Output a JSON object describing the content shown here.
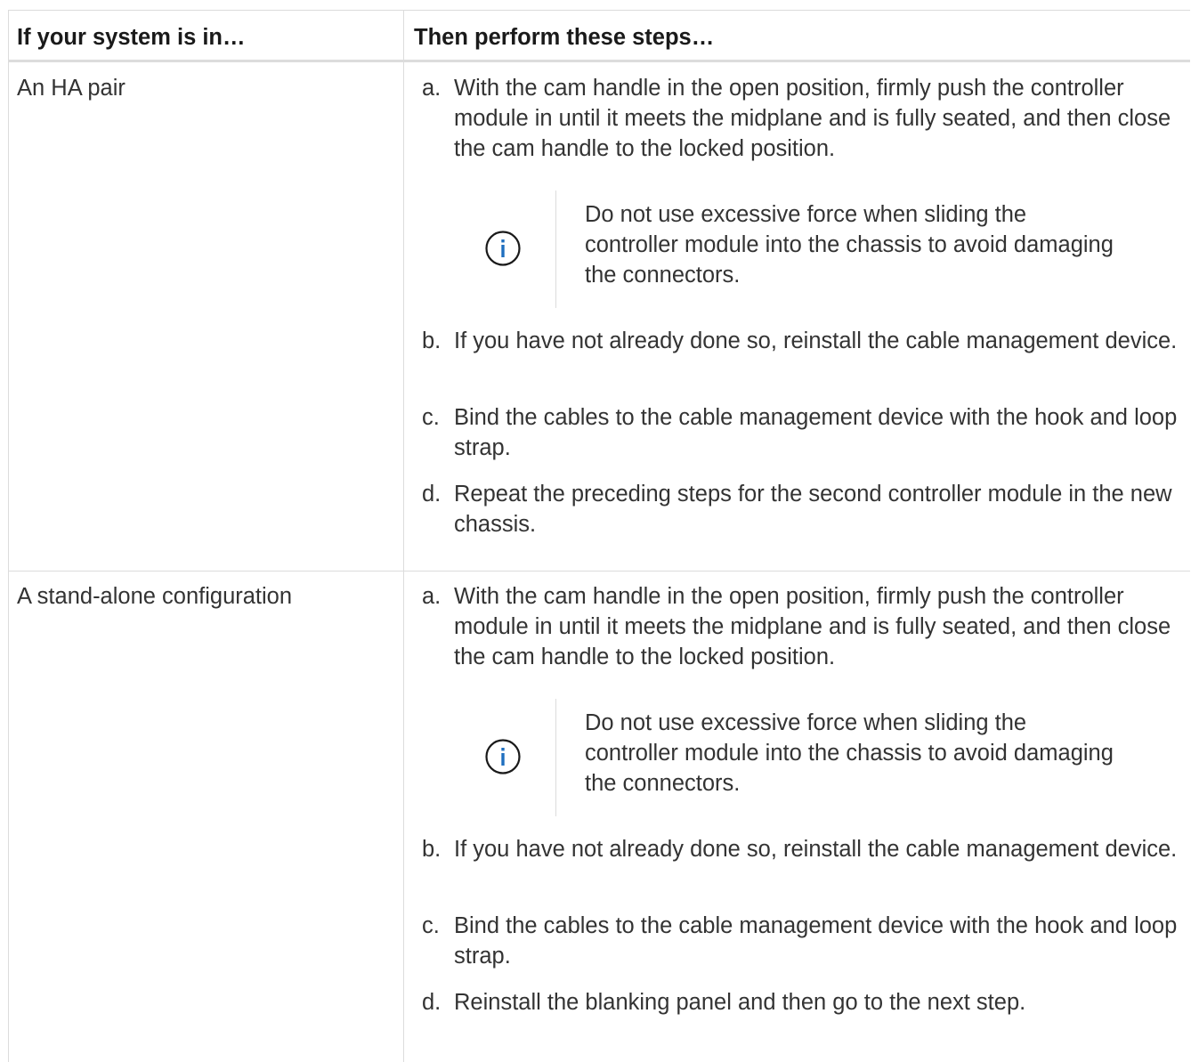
{
  "table": {
    "headers": [
      "If your system is in…",
      "Then perform these steps…"
    ],
    "rows": [
      {
        "condition": "An HA pair",
        "steps": {
          "a": {
            "marker": "a.",
            "text": "With the cam handle in the open position, firmly push the controller module in until it meets the midplane and is fully seated, and then close the cam handle to the locked position."
          },
          "note": "Do not use excessive force when sliding the controller module into the chassis to avoid damaging the connectors.",
          "b": {
            "marker": "b.",
            "text": "If you have not already done so, reinstall the cable management device."
          },
          "c": {
            "marker": "c.",
            "text": "Bind the cables to the cable management device with the hook and loop strap."
          },
          "d": {
            "marker": "d.",
            "text": "Repeat the preceding steps for the second controller module in the new chassis."
          }
        }
      },
      {
        "condition": "A stand-alone configuration",
        "steps": {
          "a": {
            "marker": "a.",
            "text": "With the cam handle in the open position, firmly push the controller module in until it meets the midplane and is fully seated, and then close the cam handle to the locked position."
          },
          "note": "Do not use excessive force when sliding the controller module into the chassis to avoid damaging the connectors.",
          "b": {
            "marker": "b.",
            "text": "If you have not already done so, reinstall the cable management device."
          },
          "c": {
            "marker": "c.",
            "text": "Bind the cables to the cable management device with the hook and loop strap."
          },
          "d": {
            "marker": "d.",
            "text": "Reinstall the blanking panel and then go to the next step."
          }
        }
      }
    ]
  },
  "icons": {
    "note": "info-circle-icon"
  },
  "colors": {
    "info_icon": "#1f6fbf",
    "border": "#dcdcdc",
    "text": "#333333"
  }
}
